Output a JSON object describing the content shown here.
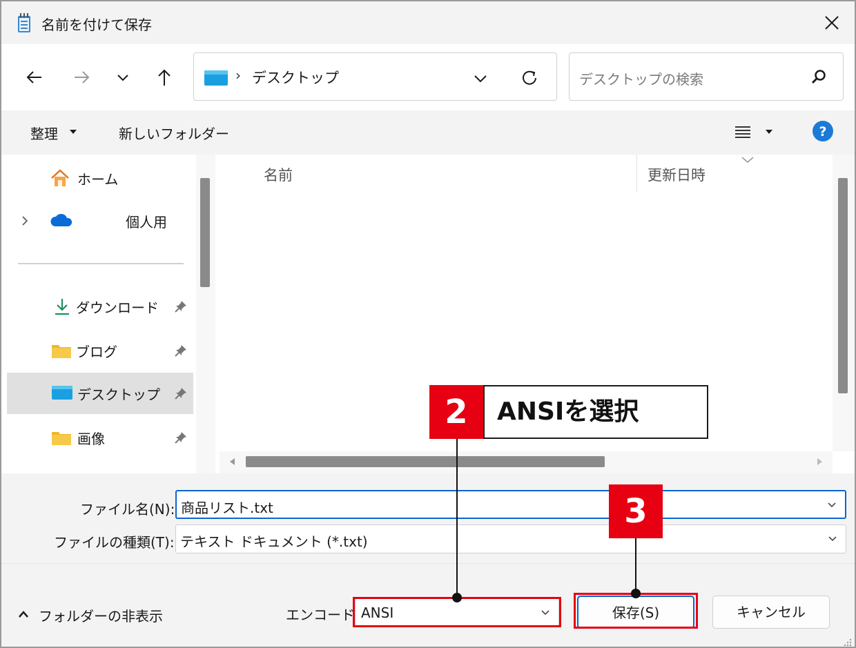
{
  "window": {
    "title": "名前を付けて保存"
  },
  "nav": {
    "address_path": "デスクトップ",
    "search_placeholder": "デスクトップの検索"
  },
  "commands": {
    "organize": "整理",
    "new_folder": "新しいフォルダー"
  },
  "sidebar": {
    "items": [
      {
        "label": "ホーム",
        "icon": "home-icon",
        "pinned": false
      },
      {
        "label": "個人用",
        "icon": "onedrive-cloud-icon",
        "pinned": false
      },
      {
        "label": "ダウンロード",
        "icon": "download-icon",
        "pinned": true
      },
      {
        "label": "ブログ",
        "icon": "folder-icon",
        "pinned": true
      },
      {
        "label": "デスクトップ",
        "icon": "desktop-folder-icon",
        "pinned": true,
        "selected": true
      },
      {
        "label": "画像",
        "icon": "folder-icon",
        "pinned": true
      }
    ]
  },
  "file_list": {
    "columns": [
      "名前",
      "更新日時"
    ]
  },
  "fields": {
    "filename_label": "ファイル名(N):",
    "filename_value": "商品リスト.txt",
    "filetype_label": "ファイルの種類(T):",
    "filetype_value": "テキスト ドキュメント (*.txt)"
  },
  "bottom": {
    "hide_folders": "フォルダーの非表示",
    "encoding_label": "エンコード:",
    "encoding_value": "ANSI",
    "save_button": "保存(S)",
    "cancel_button": "キャンセル"
  },
  "annotations": {
    "step2_number": "2",
    "step2_text": "ANSIを選択",
    "step3_number": "3"
  },
  "colors": {
    "accent": "#0a64d2",
    "annotation_red": "#e60012",
    "window_bg": "#f3f3f3"
  }
}
